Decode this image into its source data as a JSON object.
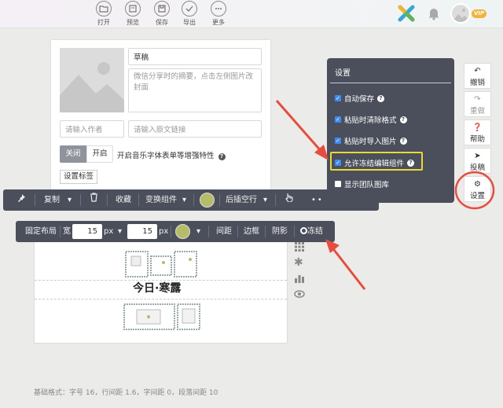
{
  "toolbar": {
    "buttons": [
      {
        "label": "打开",
        "icon": "open-icon"
      },
      {
        "label": "预览",
        "icon": "preview-icon"
      },
      {
        "label": "保存",
        "icon": "save-icon"
      },
      {
        "label": "导出",
        "icon": "export-icon"
      },
      {
        "label": "更多",
        "icon": "more-icon"
      }
    ],
    "vip_badge": "VIP"
  },
  "article": {
    "title_value": "草稿",
    "summary_placeholder": "微信分享时的摘要，点击左侧图片改封面",
    "author_placeholder": "请输入作者",
    "link_placeholder": "请输入原文链接",
    "toggle_off": "关闭",
    "toggle_on": "开启",
    "music_label": "开启音乐字体表单等增强特性",
    "tag_button": "设置标签"
  },
  "component_toolbar": {
    "copy": "复制",
    "collect": "收藏",
    "transform": "变换组件",
    "insert_blank": "后插空行",
    "color": "#b5bd68"
  },
  "layout_toolbar": {
    "fixed_layout": "固定布局",
    "width_label": "宽",
    "width_value": "15",
    "unit1": "px",
    "height_value": "15",
    "unit2": "px",
    "spacing": "间距",
    "border": "边框",
    "shadow": "阴影",
    "freeze": "冻结",
    "color": "#b5bd68"
  },
  "editor": {
    "heading": "今日·寒露"
  },
  "settings": {
    "title": "设置",
    "items": [
      {
        "label": "自动保存",
        "checked": true
      },
      {
        "label": "粘贴时清除格式",
        "checked": true
      },
      {
        "label": "粘贴时导入图片",
        "checked": true
      },
      {
        "label": "允许冻结编辑组件",
        "checked": true
      },
      {
        "label": "显示团队图库",
        "checked": false
      }
    ]
  },
  "sidebar": {
    "undo": "撤销",
    "redo": "重做",
    "help": "帮助",
    "submit": "投稿",
    "settings": "设置"
  },
  "footer": {
    "format_text": "基础格式：字号 16，行间距 1.6，字间距 0，段落间距 10"
  },
  "colors": {
    "accent_red": "#e84c3d",
    "dark_panel": "#4b4f5c",
    "highlight": "#e8d83a"
  }
}
